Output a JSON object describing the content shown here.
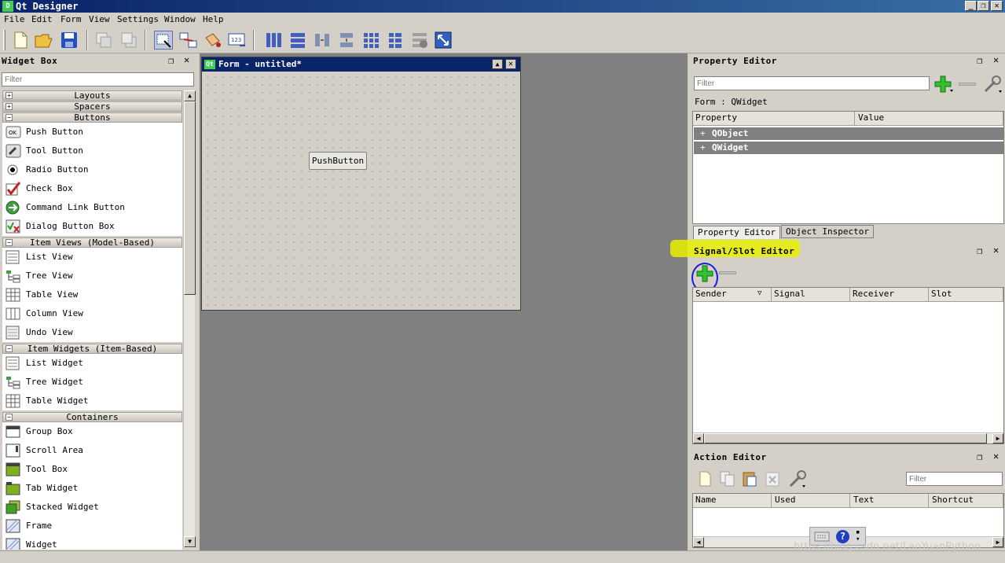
{
  "app": {
    "title": "Qt Designer",
    "logo": "D"
  },
  "menu": [
    "File",
    "Edit",
    "Form",
    "View",
    "Settings",
    "Window",
    "Help"
  ],
  "widget_box": {
    "title": "Widget Box",
    "filter_placeholder": "Filter",
    "categories": {
      "layouts": "Layouts",
      "spacers": "Spacers",
      "buttons": "Buttons",
      "item_views": "Item Views (Model-Based)",
      "item_widgets": "Item Widgets (Item-Based)",
      "containers": "Containers"
    },
    "buttons": [
      "Push Button",
      "Tool Button",
      "Radio Button",
      "Check Box",
      "Command Link Button",
      "Dialog Button Box"
    ],
    "item_views": [
      "List View",
      "Tree View",
      "Table View",
      "Column View",
      "Undo View"
    ],
    "item_widgets": [
      "List Widget",
      "Tree Widget",
      "Table Widget"
    ],
    "containers": [
      "Group Box",
      "Scroll Area",
      "Tool Box",
      "Tab Widget",
      "Stacked Widget",
      "Frame",
      "Widget"
    ]
  },
  "form": {
    "title": "Form - untitled*",
    "logo": "Qt",
    "push_button": "PushButton"
  },
  "property_editor": {
    "title": "Property Editor",
    "filter_placeholder": "Filter",
    "object_label": "Form : QWidget",
    "col_property": "Property",
    "col_value": "Value",
    "groups": [
      "QObject",
      "QWidget"
    ],
    "tabs": [
      "Property Editor",
      "Object Inspector"
    ]
  },
  "signal_slot": {
    "title": "Signal/Slot Editor",
    "columns": [
      "Sender",
      "Signal",
      "Receiver",
      "Slot"
    ]
  },
  "action_editor": {
    "title": "Action Editor",
    "filter_placeholder": "Filter",
    "columns": [
      "Name",
      "Used",
      "Text",
      "Shortcut"
    ]
  },
  "watermark": "https://blog.csdn.net/LaoYuanPython",
  "colors": {
    "titlebar": "#0a246a",
    "highlight": "#e8f000",
    "annotation_circle": "#1a1adc",
    "green_plus": "#22b022"
  }
}
